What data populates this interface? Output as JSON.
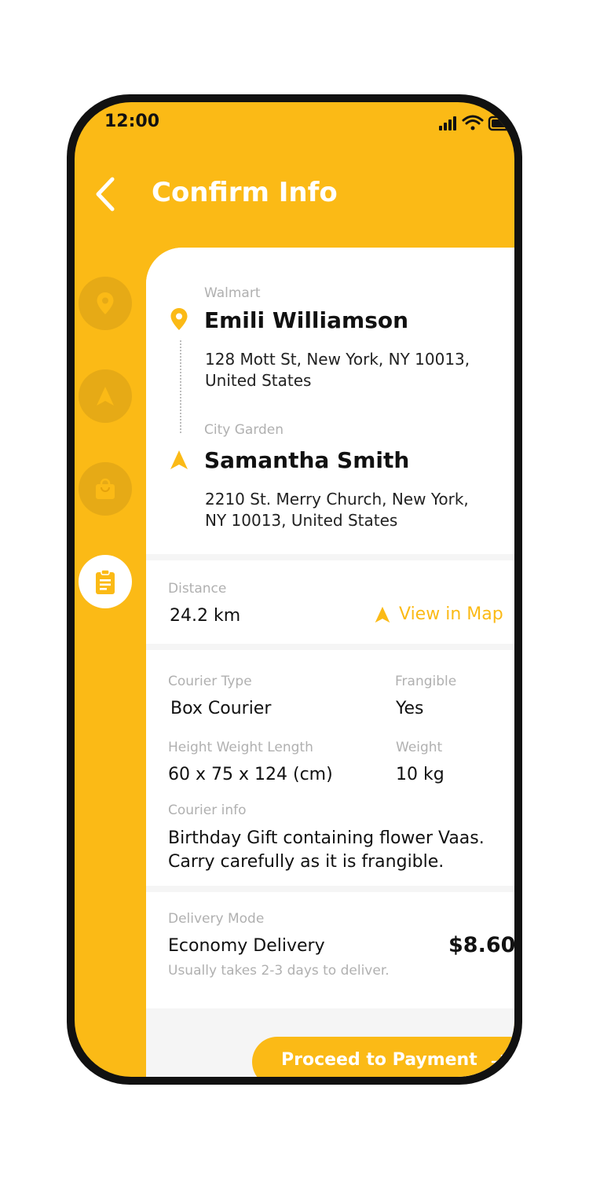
{
  "status_bar": {
    "time": "12:00"
  },
  "header": {
    "title": "Confirm Info"
  },
  "colors": {
    "accent": "#FBBA16",
    "text": "#111111",
    "muted": "#B0B0B0"
  },
  "side_steps": [
    {
      "icon": "location-pin-icon"
    },
    {
      "icon": "navigation-arrow-icon"
    },
    {
      "icon": "shopping-bag-icon"
    },
    {
      "icon": "clipboard-icon",
      "active": true
    }
  ],
  "pickup": {
    "label": "Walmart",
    "name": "Emili Williamson",
    "address_line1": "128 Mott St, New York, NY 10013,",
    "address_line2": "United States"
  },
  "dropoff": {
    "label": "City Garden",
    "name": "Samantha Smith",
    "address_line1": "2210 St. Merry Church, New York,",
    "address_line2": "NY 10013, United States"
  },
  "distance": {
    "label": "Distance",
    "value": "24.2 km",
    "map_link": "View in Map"
  },
  "courier": {
    "type_label": "Courier Type",
    "type_value": "Box Courier",
    "frangible_label": "Frangible",
    "frangible_value": "Yes",
    "dims_label": "Height Weight Length",
    "dims_value": "60 x 75 x 124 (cm)",
    "weight_label": "Weight",
    "weight_value": "10 kg",
    "info_label": "Courier info",
    "info_line1": "Birthday Gift containing flower Vaas.",
    "info_line2": "Carry carefully as it is frangible."
  },
  "delivery": {
    "label": "Delivery Mode",
    "mode": "Economy Delivery",
    "note": "Usually takes 2-3 days to deliver.",
    "price": "$8.60"
  },
  "cta": {
    "label": "Proceed to Payment"
  }
}
